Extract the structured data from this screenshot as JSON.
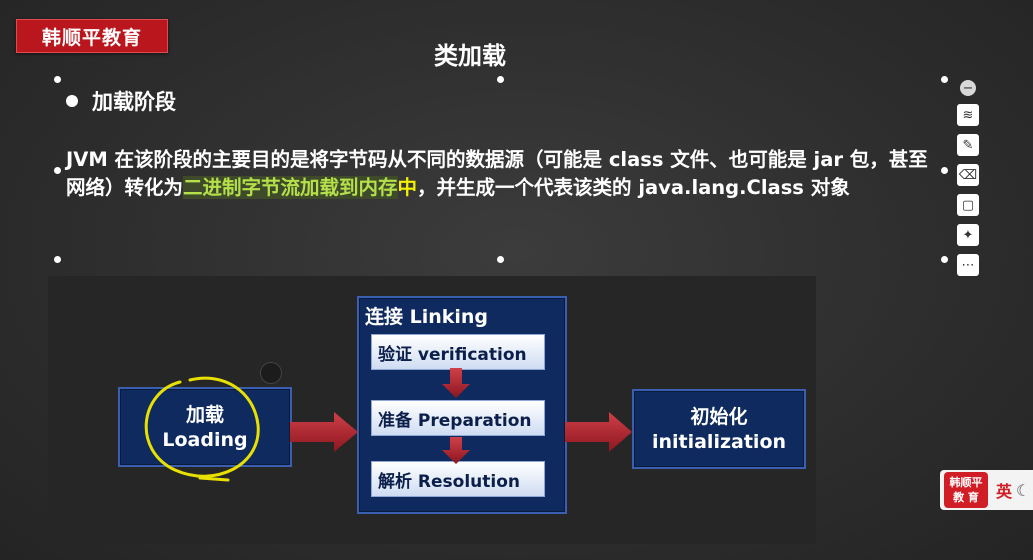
{
  "brand": {
    "label": "韩顺平教育"
  },
  "slide": {
    "title": "类加载",
    "section_heading": "加载阶段",
    "paragraph": {
      "part1": "JVM 在该阶段的主要目的是将字节码从不同的数据源（可能是 class 文件、也可能是 jar 包，甚至网络）转化为",
      "highlight_green": "二进制字节流加载到内存",
      "highlight_yellow": "中",
      "part2": "，并生成一个代表该类的 java.lang.Class 对象"
    }
  },
  "diagram": {
    "loading": {
      "line1": "加载",
      "line2": "Loading"
    },
    "linking": {
      "title": "连接 Linking",
      "steps": [
        "验证 verification",
        "准备 Preparation",
        "解析 Resolution"
      ]
    },
    "initialization": {
      "line1": "初始化",
      "line2": "initialization"
    }
  },
  "toolbar": {
    "icons": [
      "minus-icon",
      "layers-icon",
      "pen-icon",
      "eraser-icon",
      "page-icon",
      "bulb-icon",
      "more-icon"
    ]
  },
  "badge": {
    "logo_line1": "韩顺平",
    "logo_line2": "教 育",
    "lang": "英"
  },
  "colors": {
    "brand_red": "#b9161d",
    "box_blue": "#0f2a5e",
    "arrow_red": "#b0202a",
    "highlight_green": "#b4e04a",
    "highlight_yellow": "#f4f000",
    "annotation_yellow": "#e8e000"
  }
}
